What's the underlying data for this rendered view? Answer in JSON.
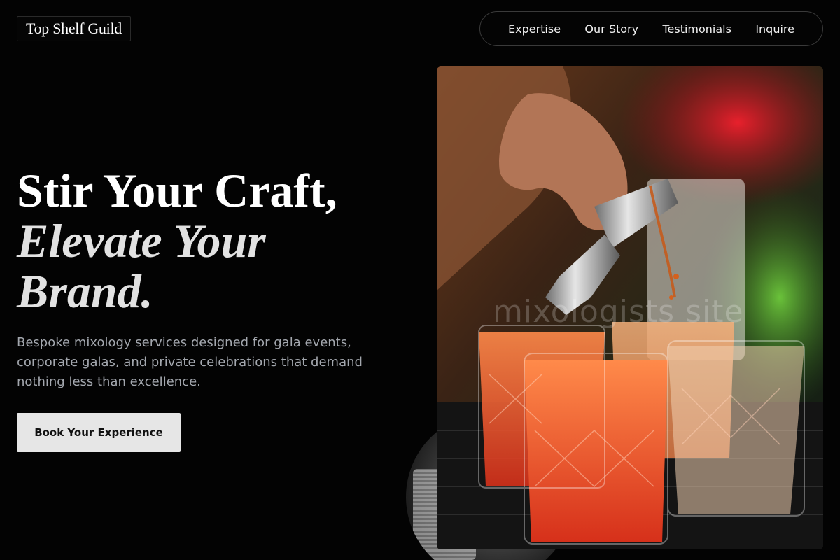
{
  "brand": {
    "name": "Top Shelf Guild"
  },
  "nav": {
    "items": [
      "Expertise",
      "Our Story",
      "Testimonials",
      "Inquire"
    ]
  },
  "hero": {
    "line1": "Stir Your Craft,",
    "line2": "Elevate Your",
    "line3": "Brand.",
    "subtitle": "Bespoke mixology services designed for gala events, corporate galas, and private celebrations that demand nothing less than excellence.",
    "cta_label": "Book Your Experience"
  },
  "image": {
    "watermark": "mixologists site"
  },
  "colors": {
    "background": "#030303",
    "cta_bg": "#e6e6e6",
    "subtitle_text": "#a3a7ae"
  }
}
